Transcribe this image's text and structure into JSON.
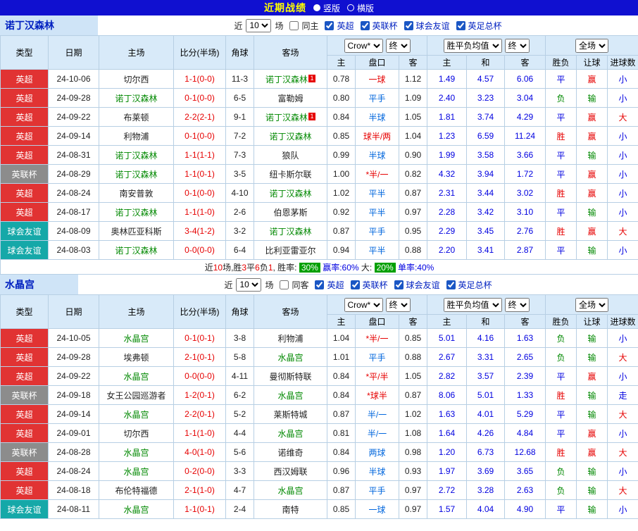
{
  "topbar": {
    "title": "近期战绩",
    "vertical": "竖版",
    "horizontal": "横版"
  },
  "filter_labels": {
    "recent": "近",
    "count": "10",
    "games": "场"
  },
  "header": {
    "type": "类型",
    "date": "日期",
    "home": "主场",
    "score": "比分(半场)",
    "corner": "角球",
    "away": "客场",
    "odds_source": "Crow*",
    "odds_final": "终",
    "europe": "胜平负均值",
    "europe_final": "终",
    "scope": "全场",
    "h": "主",
    "handicap": "盘口",
    "a": "客",
    "eh": "主",
    "ed": "和",
    "ea": "客",
    "result": "胜负",
    "cover": "让球",
    "goal": "进球数"
  },
  "colors": {
    "type": {
      "英超": "#e13333",
      "英联杯": "#8c8c8c",
      "球会友谊": "#15a8a8"
    },
    "result": {
      "胜": "#e60000",
      "平": "#0000e0",
      "负": "#008800"
    },
    "cover": {
      "赢": "#e60000",
      "输": "#008800"
    },
    "goals": {
      "大": "#e60000",
      "小": "#0000e0",
      "走": "#0000e0"
    },
    "handicap": {
      "r": "#e60000",
      "b": "#0066dd"
    }
  },
  "sections": [
    {
      "team": "诺丁汉森林",
      "same_label": "同主",
      "leagues": [
        "英超",
        "英联杯",
        "球会友谊",
        "英足总杯"
      ],
      "rows": [
        {
          "type": "英超",
          "date": "24-10-06",
          "home": "切尔西",
          "home_focal": false,
          "score": "1-1(0-0)",
          "corner": "11-3",
          "away": "诺丁汉森林",
          "away_focal": true,
          "away_badge": "1",
          "h": "0.78",
          "hcp": "一球",
          "hcp_c": "r",
          "a": "1.12",
          "eh": "1.49",
          "ed": "4.57",
          "ea": "6.06",
          "res": "平",
          "cover": "赢",
          "goal": "小"
        },
        {
          "type": "英超",
          "date": "24-09-28",
          "home": "诺丁汉森林",
          "home_focal": true,
          "score": "0-1(0-0)",
          "corner": "6-5",
          "away": "富勒姆",
          "away_focal": false,
          "h": "0.80",
          "hcp": "平手",
          "hcp_c": "b",
          "a": "1.09",
          "eh": "2.40",
          "ed": "3.23",
          "ea": "3.04",
          "res": "负",
          "cover": "输",
          "goal": "小"
        },
        {
          "type": "英超",
          "date": "24-09-22",
          "home": "布莱顿",
          "home_focal": false,
          "score": "2-2(2-1)",
          "corner": "9-1",
          "away": "诺丁汉森林",
          "away_focal": true,
          "away_badge": "1",
          "h": "0.84",
          "hcp": "半球",
          "hcp_c": "b",
          "a": "1.05",
          "eh": "1.81",
          "ed": "3.74",
          "ea": "4.29",
          "res": "平",
          "cover": "赢",
          "goal": "大"
        },
        {
          "type": "英超",
          "date": "24-09-14",
          "home": "利物浦",
          "home_focal": false,
          "score": "0-1(0-0)",
          "corner": "7-2",
          "away": "诺丁汉森林",
          "away_focal": true,
          "h": "0.85",
          "hcp": "球半/两",
          "hcp_c": "r",
          "a": "1.04",
          "eh": "1.23",
          "ed": "6.59",
          "ea": "11.24",
          "res": "胜",
          "cover": "赢",
          "goal": "小"
        },
        {
          "type": "英超",
          "date": "24-08-31",
          "home": "诺丁汉森林",
          "home_focal": true,
          "score": "1-1(1-1)",
          "corner": "7-3",
          "away": "狼队",
          "away_focal": false,
          "h": "0.99",
          "hcp": "半球",
          "hcp_c": "b",
          "a": "0.90",
          "eh": "1.99",
          "ed": "3.58",
          "ea": "3.66",
          "res": "平",
          "cover": "输",
          "goal": "小"
        },
        {
          "type": "英联杯",
          "date": "24-08-29",
          "home": "诺丁汉森林",
          "home_focal": true,
          "score": "1-1(0-1)",
          "corner": "3-5",
          "away": "纽卡斯尔联",
          "away_focal": false,
          "h": "1.00",
          "hcp": "*半/一",
          "hcp_c": "r",
          "a": "0.82",
          "eh": "4.32",
          "ed": "3.94",
          "ea": "1.72",
          "res": "平",
          "cover": "赢",
          "goal": "小"
        },
        {
          "type": "英超",
          "date": "24-08-24",
          "home": "南安普敦",
          "home_focal": false,
          "score": "0-1(0-0)",
          "corner": "4-10",
          "away": "诺丁汉森林",
          "away_focal": true,
          "h": "1.02",
          "hcp": "平半",
          "hcp_c": "b",
          "a": "0.87",
          "eh": "2.31",
          "ed": "3.44",
          "ea": "3.02",
          "res": "胜",
          "cover": "赢",
          "goal": "小"
        },
        {
          "type": "英超",
          "date": "24-08-17",
          "home": "诺丁汉森林",
          "home_focal": true,
          "score": "1-1(1-0)",
          "corner": "2-6",
          "away": "伯恩茅斯",
          "away_focal": false,
          "h": "0.92",
          "hcp": "平半",
          "hcp_c": "b",
          "a": "0.97",
          "eh": "2.28",
          "ed": "3.42",
          "ea": "3.10",
          "res": "平",
          "cover": "输",
          "goal": "小"
        },
        {
          "type": "球会友谊",
          "date": "24-08-09",
          "home": "奥林匹亚科斯",
          "home_focal": false,
          "score": "3-4(1-2)",
          "corner": "3-2",
          "away": "诺丁汉森林",
          "away_focal": true,
          "h": "0.87",
          "hcp": "平手",
          "hcp_c": "b",
          "a": "0.95",
          "eh": "2.29",
          "ed": "3.45",
          "ea": "2.76",
          "res": "胜",
          "cover": "赢",
          "goal": "大"
        },
        {
          "type": "球会友谊",
          "date": "24-08-03",
          "home": "诺丁汉森林",
          "home_focal": true,
          "score": "0-0(0-0)",
          "corner": "6-4",
          "away": "比利亚雷亚尔",
          "away_focal": false,
          "h": "0.94",
          "hcp": "平半",
          "hcp_c": "b",
          "a": "0.88",
          "eh": "2.20",
          "ed": "3.41",
          "ea": "2.87",
          "res": "平",
          "cover": "输",
          "goal": "小"
        }
      ],
      "summary": [
        {
          "t": "近",
          "s": "plain"
        },
        {
          "t": "10",
          "s": "red"
        },
        {
          "t": "场,胜",
          "s": "plain"
        },
        {
          "t": "3",
          "s": "red"
        },
        {
          "t": "平",
          "s": "plain"
        },
        {
          "t": "6",
          "s": "red"
        },
        {
          "t": "负",
          "s": "plain"
        },
        {
          "t": "1",
          "s": "red"
        },
        {
          "t": ", 胜率: ",
          "s": "plain"
        },
        {
          "t": "30%",
          "s": "badge"
        },
        {
          "t": " 赢率:60%",
          "s": "blue"
        },
        {
          "t": " 大: ",
          "s": "plain"
        },
        {
          "t": "20%",
          "s": "badge"
        },
        {
          "t": " 单率:40%",
          "s": "blue"
        }
      ]
    },
    {
      "team": "水晶宫",
      "same_label": "同客",
      "leagues": [
        "英超",
        "英联杯",
        "球会友谊",
        "英足总杯"
      ],
      "rows": [
        {
          "type": "英超",
          "date": "24-10-05",
          "home": "水晶宫",
          "home_focal": true,
          "score": "0-1(0-1)",
          "corner": "3-8",
          "away": "利物浦",
          "away_focal": false,
          "h": "1.04",
          "hcp": "*半/一",
          "hcp_c": "r",
          "a": "0.85",
          "eh": "5.01",
          "ed": "4.16",
          "ea": "1.63",
          "res": "负",
          "cover": "输",
          "goal": "小"
        },
        {
          "type": "英超",
          "date": "24-09-28",
          "home": "埃弗顿",
          "home_focal": false,
          "score": "2-1(0-1)",
          "corner": "5-8",
          "away": "水晶宫",
          "away_focal": true,
          "h": "1.01",
          "hcp": "平手",
          "hcp_c": "b",
          "a": "0.88",
          "eh": "2.67",
          "ed": "3.31",
          "ea": "2.65",
          "res": "负",
          "cover": "输",
          "goal": "大"
        },
        {
          "type": "英超",
          "date": "24-09-22",
          "home": "水晶宫",
          "home_focal": true,
          "score": "0-0(0-0)",
          "corner": "4-11",
          "away": "曼彻斯特联",
          "away_focal": false,
          "h": "0.84",
          "hcp": "*平/半",
          "hcp_c": "r",
          "a": "1.05",
          "eh": "2.82",
          "ed": "3.57",
          "ea": "2.39",
          "res": "平",
          "cover": "赢",
          "goal": "小"
        },
        {
          "type": "英联杯",
          "date": "24-09-18",
          "home": "女王公园巡游者",
          "home_focal": false,
          "score": "1-2(0-1)",
          "corner": "6-2",
          "away": "水晶宫",
          "away_focal": true,
          "h": "0.84",
          "hcp": "*球半",
          "hcp_c": "r",
          "a": "0.87",
          "eh": "8.06",
          "ed": "5.01",
          "ea": "1.33",
          "res": "胜",
          "cover": "输",
          "goal": "走"
        },
        {
          "type": "英超",
          "date": "24-09-14",
          "home": "水晶宫",
          "home_focal": true,
          "score": "2-2(0-1)",
          "corner": "5-2",
          "away": "莱斯特城",
          "away_focal": false,
          "h": "0.87",
          "hcp": "半/一",
          "hcp_c": "b",
          "a": "1.02",
          "eh": "1.63",
          "ed": "4.01",
          "ea": "5.29",
          "res": "平",
          "cover": "输",
          "goal": "大"
        },
        {
          "type": "英超",
          "date": "24-09-01",
          "home": "切尔西",
          "home_focal": false,
          "score": "1-1(1-0)",
          "corner": "4-4",
          "away": "水晶宫",
          "away_focal": true,
          "h": "0.81",
          "hcp": "半/一",
          "hcp_c": "b",
          "a": "1.08",
          "eh": "1.64",
          "ed": "4.26",
          "ea": "4.84",
          "res": "平",
          "cover": "赢",
          "goal": "小"
        },
        {
          "type": "英联杯",
          "date": "24-08-28",
          "home": "水晶宫",
          "home_focal": true,
          "score": "4-0(1-0)",
          "corner": "5-6",
          "away": "诺维奇",
          "away_focal": false,
          "h": "0.84",
          "hcp": "两球",
          "hcp_c": "b",
          "a": "0.98",
          "eh": "1.20",
          "ed": "6.73",
          "ea": "12.68",
          "res": "胜",
          "cover": "赢",
          "goal": "大"
        },
        {
          "type": "英超",
          "date": "24-08-24",
          "home": "水晶宫",
          "home_focal": true,
          "score": "0-2(0-0)",
          "corner": "3-3",
          "away": "西汉姆联",
          "away_focal": false,
          "h": "0.96",
          "hcp": "半球",
          "hcp_c": "b",
          "a": "0.93",
          "eh": "1.97",
          "ed": "3.69",
          "ea": "3.65",
          "res": "负",
          "cover": "输",
          "goal": "小"
        },
        {
          "type": "英超",
          "date": "24-08-18",
          "home": "布伦特福德",
          "home_focal": false,
          "score": "2-1(1-0)",
          "corner": "4-7",
          "away": "水晶宫",
          "away_focal": true,
          "h": "0.87",
          "hcp": "平手",
          "hcp_c": "b",
          "a": "0.97",
          "eh": "2.72",
          "ed": "3.28",
          "ea": "2.63",
          "res": "负",
          "cover": "输",
          "goal": "大"
        },
        {
          "type": "球会友谊",
          "date": "24-08-11",
          "home": "水晶宫",
          "home_focal": true,
          "score": "1-1(0-1)",
          "corner": "2-4",
          "away": "南特",
          "away_focal": false,
          "h": "0.85",
          "hcp": "一球",
          "hcp_c": "b",
          "a": "0.97",
          "eh": "1.57",
          "ed": "4.04",
          "ea": "4.90",
          "res": "平",
          "cover": "输",
          "goal": "小"
        }
      ],
      "summary": []
    }
  ]
}
